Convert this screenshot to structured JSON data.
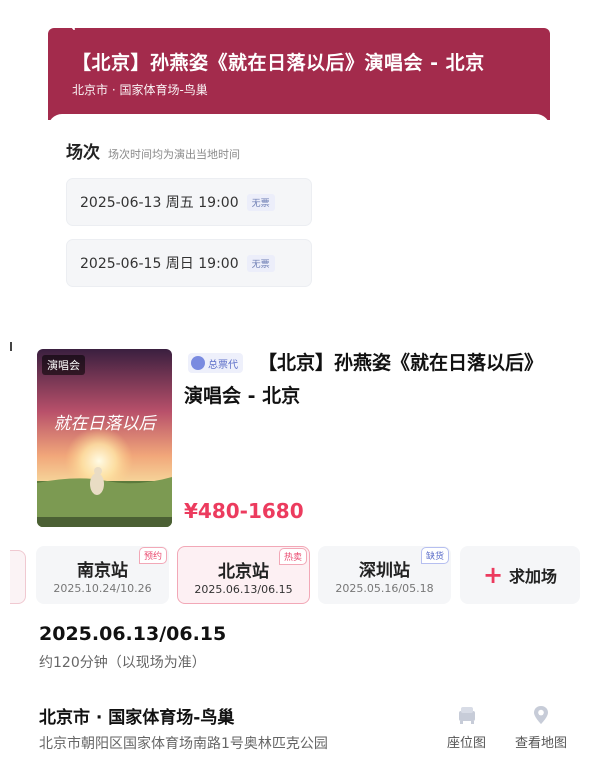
{
  "top": {
    "title": "【北京】孙燕姿《就在日落以后》演唱会 - 北京",
    "venue": "北京市 · 国家体育场-鸟巢",
    "sessions_label": "场次",
    "sessions_note": "场次时间均为演出当地时间",
    "sessions": [
      {
        "date": "2025-06-13 周五 19:00",
        "badge": "无票"
      },
      {
        "date": "2025-06-15 周日 19:00",
        "badge": "无票"
      }
    ]
  },
  "event": {
    "poster_tag": "演唱会",
    "poster_title": "就在日落以后",
    "agent_badge": "总票代",
    "title_line1": "【北京】孙燕姿《就在日落以后》",
    "title_line2": "演唱会 - 北京",
    "price": "¥480-1680"
  },
  "stations": [
    {
      "name": "南京站",
      "dates": "2025.10.24/10.26",
      "badge": "预约"
    },
    {
      "name": "北京站",
      "dates": "2025.06.13/06.15",
      "badge": "热卖"
    },
    {
      "name": "深圳站",
      "dates": "2025.05.16/05.18",
      "badge": "缺货"
    }
  ],
  "add_session": {
    "plus": "+",
    "label": "求加场"
  },
  "details": {
    "date_range": "2025.06.13/06.15",
    "duration": "约120分钟（以现场为准）",
    "venue_name": "北京市 · 国家体育场-鸟巢",
    "venue_address": "北京市朝阳区国家体育场南路1号奥林匹克公园",
    "seat_map_label": "座位图",
    "map_label": "查看地图"
  },
  "colors": {
    "header_bg": "#a32b4c",
    "price": "#ec3b5e",
    "active_station_border": "#f2a8b7",
    "badge_text": "#6c7cb3"
  },
  "icons": [
    "back-chevron-icon",
    "agent-icon",
    "plus-icon",
    "seat-map-icon",
    "map-pin-icon"
  ]
}
